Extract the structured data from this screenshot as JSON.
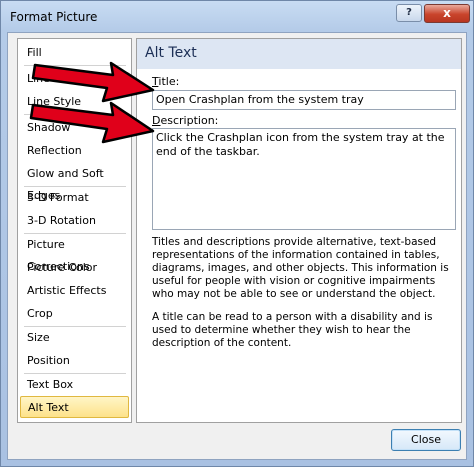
{
  "window": {
    "title": "Format Picture",
    "help_glyph": "?",
    "close_glyph": "x"
  },
  "nav": {
    "items": [
      "Fill",
      "Line Color",
      "Line Style",
      "Shadow",
      "Reflection",
      "Glow and Soft Edges",
      "3-D Format",
      "3-D Rotation",
      "Picture Corrections",
      "Picture Color",
      "Artistic Effects",
      "Crop",
      "Size",
      "Position",
      "Text Box",
      "Alt Text"
    ],
    "selected": "Alt Text"
  },
  "panel": {
    "heading": "Alt Text",
    "title_label_key": "T",
    "title_label_rest": "itle:",
    "title_value": "Open Crashplan from the system tray",
    "desc_label_key": "D",
    "desc_label_rest": "escription:",
    "desc_value": "Click the Crashplan icon from the system tray at the end of the taskbar.",
    "help_paragraph_1": "Titles and descriptions provide alternative, text-based representations of the information contained in tables, diagrams, images, and other objects. This information is useful for people with vision or cognitive impairments who may not be able to see or understand the object.",
    "help_paragraph_2": "A title can be read to a person with a disability and is used to determine whether they wish to hear the description of the content."
  },
  "footer": {
    "close_label": "Close"
  },
  "colors": {
    "arrow": "#e0001a",
    "selected_bg": "#fde28a"
  }
}
